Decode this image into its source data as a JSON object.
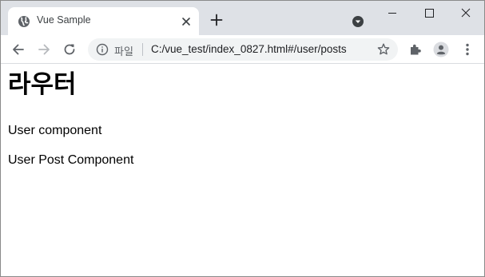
{
  "browser": {
    "tab": {
      "title": "Vue Sample"
    },
    "omnibox": {
      "scheme_label": "파일",
      "url": "C:/vue_test/index_0827.html#/user/posts"
    },
    "icons": {
      "favicon": "globe-icon",
      "close": "close-icon",
      "new_tab": "plus-icon",
      "tab_search": "chevron-down-icon",
      "back": "arrow-left-icon",
      "forward": "arrow-right-icon",
      "reload": "reload-icon",
      "info": "info-icon",
      "bookmark": "star-icon",
      "extensions": "puzzle-icon",
      "profile": "avatar-icon",
      "menu": "kebab-menu-icon"
    },
    "colors": {
      "frame": "#dee1e6",
      "omnibox": "#f1f3f4",
      "icon": "#5f6368"
    }
  },
  "page": {
    "heading": "라우터",
    "user_component": "User component",
    "user_post_component": "User Post Component"
  }
}
